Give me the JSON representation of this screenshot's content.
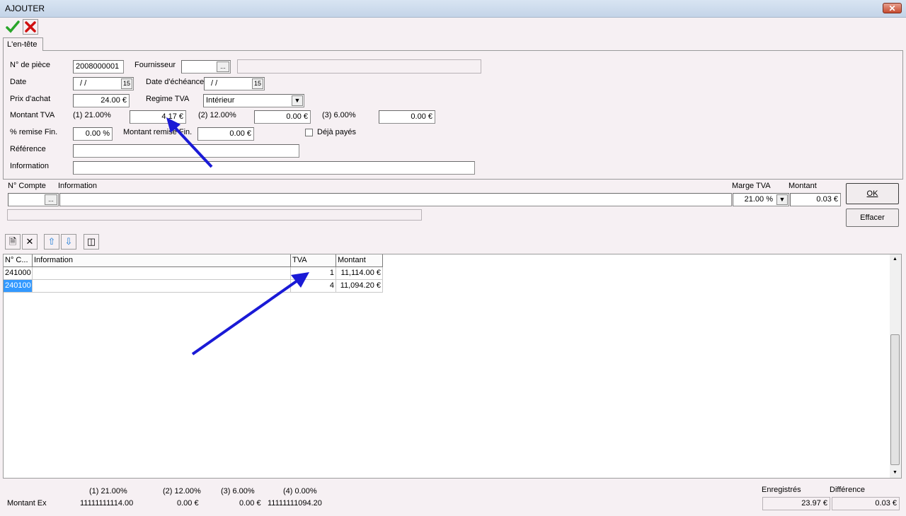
{
  "window": {
    "title": "AJOUTER",
    "close_glyph": "✕"
  },
  "toolbar": {
    "confirm_icon": "check-icon",
    "cancel_icon": "cross-icon"
  },
  "tab": {
    "label": "L'en-tête"
  },
  "header": {
    "piece_label": "N° de pièce",
    "piece_value": "2008000001",
    "supplier_label": "Fournisseur",
    "supplier_value": "",
    "supplier_btn": "...",
    "date_label": "Date",
    "date_value": "/ /",
    "due_label": "Date d'échéance",
    "due_value": "/ /",
    "price_label": "Prix d'achat",
    "price_value": "24.00 €",
    "vat_regime_label": "Regime TVA",
    "vat_regime_value": "Intérieur",
    "vat_amount_label": "Montant TVA",
    "vat1_label": "(1) 21.00%",
    "vat1_value": "4.17 €",
    "vat2_label": "(2) 12.00%",
    "vat2_value": "0.00 €",
    "vat3_label": "(3)  6.00%",
    "vat3_value": "0.00 €",
    "discount_pct_label": "% remise Fin.",
    "discount_pct_value": "0.00 %",
    "discount_amt_label": "Montant remise Fin.",
    "discount_amt_value": "0.00 €",
    "paid_label": "Déjà payés",
    "reference_label": "Référence",
    "reference_value": "",
    "info_label": "Information",
    "info_value": ""
  },
  "entry": {
    "account_label": "N° Compte",
    "account_value": "",
    "account_btn": "...",
    "info_label": "Information",
    "info_value": "",
    "vat_margin_label": "Marge TVA",
    "vat_margin_value": "21.00 %",
    "amount_label": "Montant",
    "amount_value": "0.03 €",
    "ok_label": "OK",
    "clear_label": "Effacer"
  },
  "grid": {
    "columns": [
      "N° C...",
      "Information",
      "TVA",
      "Montant"
    ],
    "rows": [
      {
        "account": "241000",
        "info": "",
        "tva": "1",
        "amount": "11,114.00 €"
      },
      {
        "account": "240100",
        "info": "",
        "tva": "4",
        "amount": "11,094.20 €"
      }
    ]
  },
  "footer": {
    "amount_ex_label": "Montant Ex",
    "c1_label": "(1) 21.00%",
    "c1_value": "11111111114.00",
    "c2_label": "(2) 12.00%",
    "c2_value": "0.00 €",
    "c3_label": "(3)  6.00%",
    "c3_value": "0.00 €",
    "c4_label": "(4)  0.00%",
    "c4_value": "11111111094.20",
    "recorded_label": "Enregistrés",
    "recorded_value": "23.97 €",
    "difference_label": "Différence",
    "difference_value": "0.03 €"
  },
  "colors": {
    "arrow": "#1a1ad6",
    "selection": "#3399ff",
    "background": "#f6f0f3"
  }
}
